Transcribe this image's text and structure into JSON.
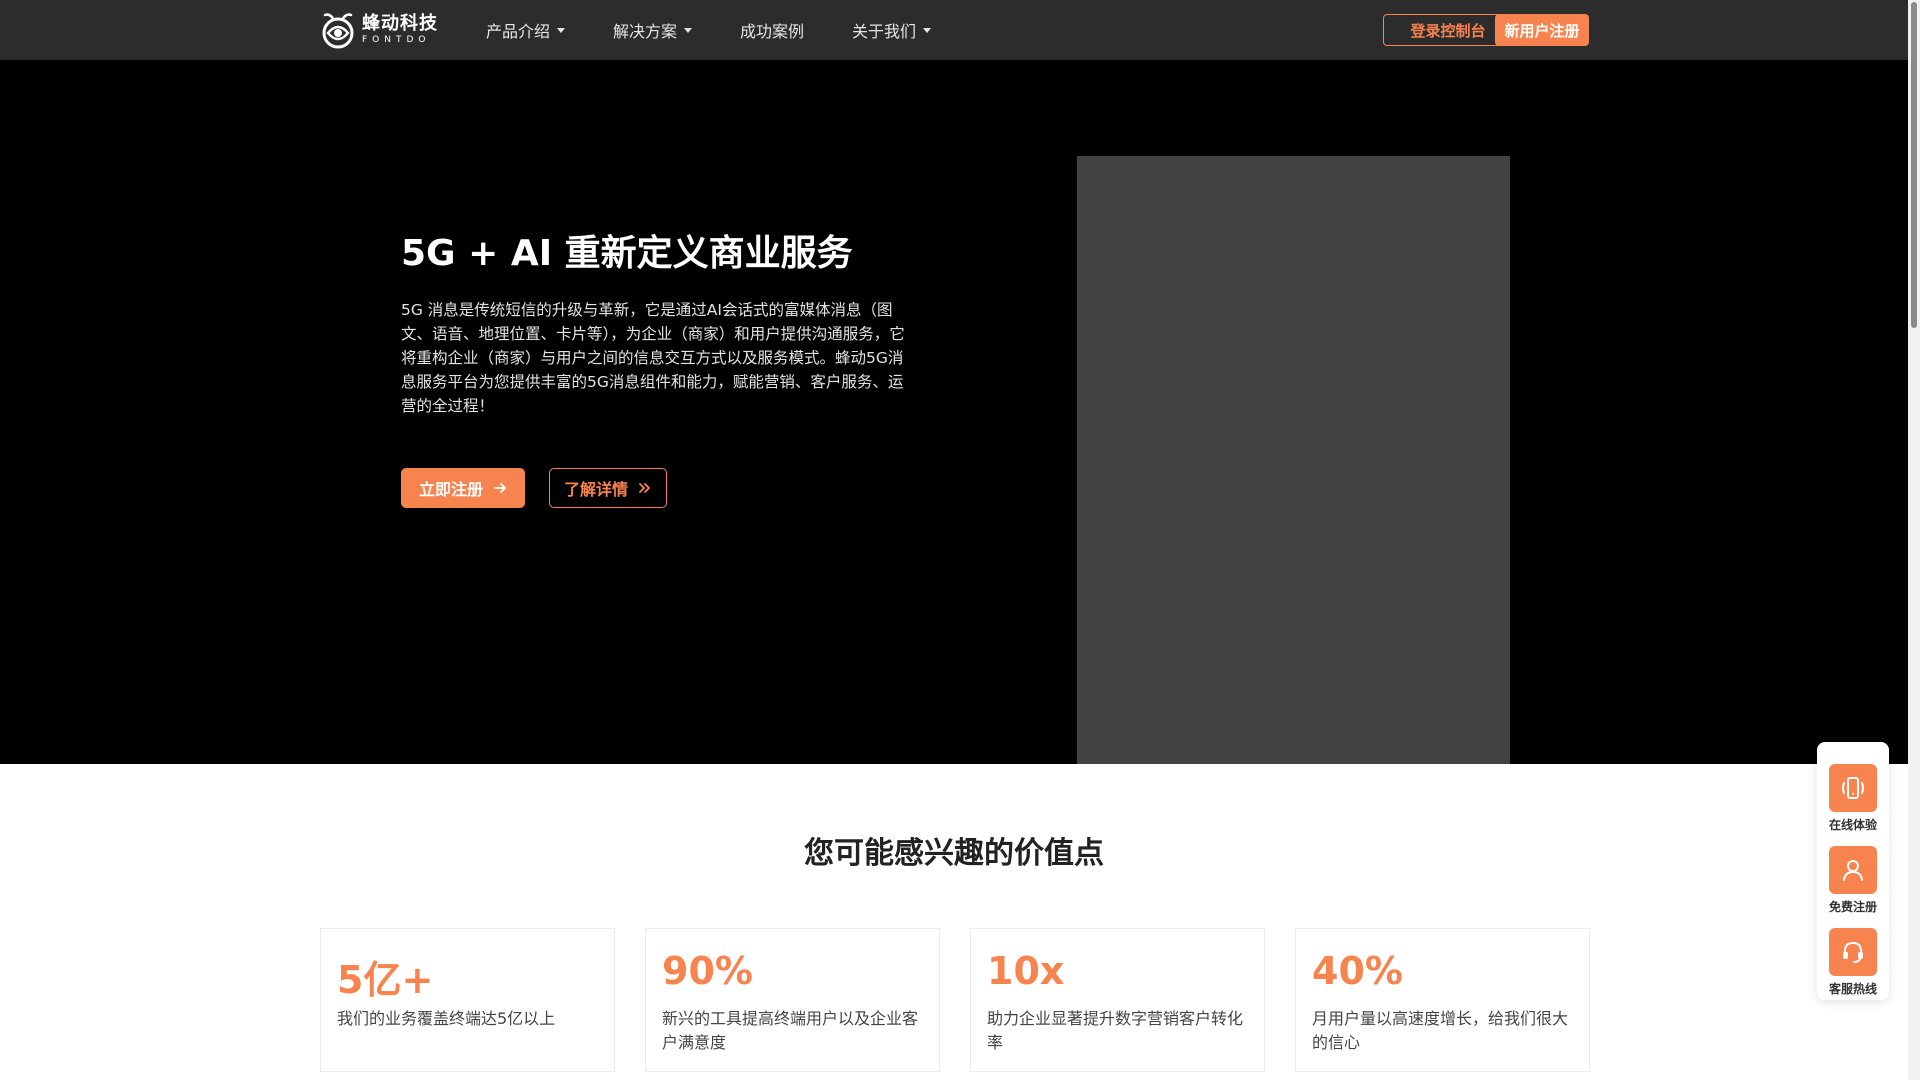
{
  "brand": {
    "name_cn": "蜂动科技",
    "name_en": "FONTDO",
    "logo_icon": "fontdo-logo-icon"
  },
  "nav": {
    "items": [
      {
        "label": "产品介绍",
        "has_dropdown": true
      },
      {
        "label": "解决方案",
        "has_dropdown": true
      },
      {
        "label": "成功案例",
        "has_dropdown": false
      },
      {
        "label": "关于我们",
        "has_dropdown": true
      }
    ],
    "login_label": "登录控制台",
    "register_label": "新用户注册"
  },
  "hero": {
    "title": "5G + AI 重新定义商业服务",
    "description": "5G 消息是传统短信的升级与革新，它是通过AI会话式的富媒体消息（图文、语音、地理位置、卡片等），为企业（商家）和用户提供沟通服务，它将重构企业（商家）与用户之间的信息交互方式以及服务模式。蜂动5G消息服务平台为您提供丰富的5G消息组件和能力，赋能营销、客户服务、运营的全过程！",
    "signup_label": "立即注册",
    "signup_icon": "arrow-right-icon",
    "more_label": "了解详情",
    "more_icon": "double-chevron-right-icon"
  },
  "values": {
    "title": "您可能感兴趣的价值点",
    "cards": [
      {
        "value": "5亿+",
        "text": "我们的业务覆盖终端达5亿以上"
      },
      {
        "value": "90%",
        "text": "新兴的工具提高终端用户以及企业客户满意度"
      },
      {
        "value": "10x",
        "text": "助力企业显著提升数字营销客户转化率"
      },
      {
        "value": "40%",
        "text": "月用户量以高速度增长，给我们很大的信心"
      }
    ]
  },
  "float_panel": {
    "items": [
      {
        "label": "在线体验",
        "icon": "phone-vibrate-icon"
      },
      {
        "label": "免费注册",
        "icon": "user-icon"
      },
      {
        "label": "客服热线",
        "icon": "headset-icon"
      }
    ]
  },
  "colors": {
    "accent": "#f7834e",
    "header_bg": "#2c2c2c",
    "hero_bg": "#000000",
    "media_placeholder": "#424242"
  }
}
